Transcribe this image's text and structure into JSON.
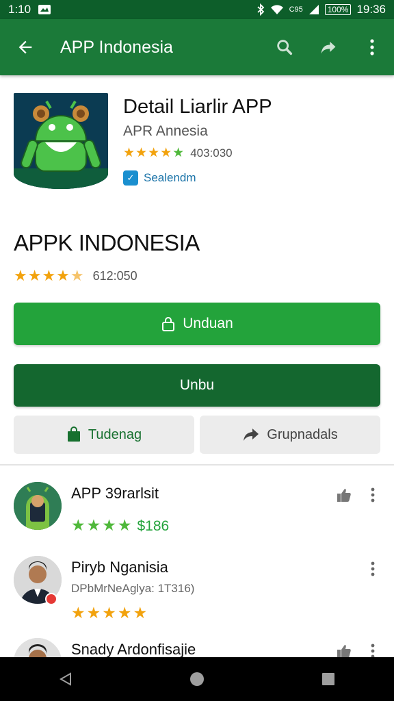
{
  "status_bar": {
    "time_left": "1:10",
    "signal_label": "C95",
    "battery_label": "100%",
    "time_right": "19:36"
  },
  "app_bar": {
    "title": "APP Indonesia"
  },
  "app": {
    "title": "Detail Liarlir APP",
    "developer": "APR Annesia",
    "rating_count": "403:030",
    "badge_label": "Sealendm",
    "big_name": "APPK INDONESIA",
    "big_rating_count": "612:050"
  },
  "buttons": {
    "primary_label": "Unduan",
    "dark_label": "Unbu",
    "left_label": "Tudenag",
    "right_label": "Grupnadals"
  },
  "list": [
    {
      "name": "APP 39rarlsit",
      "price": "$186",
      "stars": "★★★★"
    },
    {
      "name": "Piryb Nganisia",
      "subtitle": "DPbMrNeAglya: 1T316)",
      "stars": "★★★★★"
    },
    {
      "name": "Snady Ardonfisajie"
    }
  ],
  "colors": {
    "status_bar": "#0d5e2a",
    "app_bar": "#1b7a39",
    "primary": "#23a33b",
    "dark": "#14672f",
    "star": "#f2a20d"
  }
}
